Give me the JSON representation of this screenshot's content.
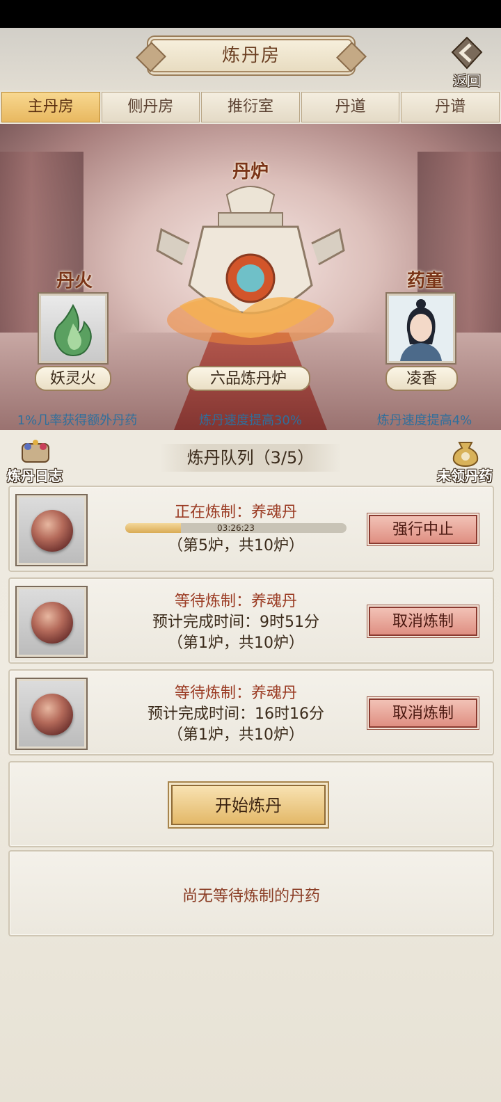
{
  "header": {
    "title": "炼丹房",
    "back_label": "返回"
  },
  "tabs": [
    {
      "label": "主丹房",
      "active": true
    },
    {
      "label": "侧丹房"
    },
    {
      "label": "推衍室"
    },
    {
      "label": "丹道"
    },
    {
      "label": "丹谱"
    }
  ],
  "scene": {
    "furnace_tag": "丹炉",
    "fire_tag": "丹火",
    "boy_tag": "药童",
    "fire_name": "妖灵火",
    "furnace_name": "六品炼丹炉",
    "boy_name": "凌香",
    "fire_desc": "1%几率获得额外丹药",
    "furnace_desc": "炼丹速度提高30%",
    "boy_desc": "炼丹速度提高4%"
  },
  "queue": {
    "title": "炼丹队列（3/5）",
    "log_label": "炼丹日志",
    "unclaimed_label": "未领丹药",
    "items": [
      {
        "status": "正在炼制：养魂丹",
        "timer": "03:26:23",
        "progress": 0.25,
        "count": "（第5炉，共10炉）",
        "action": "强行中止"
      },
      {
        "status": "等待炼制：养魂丹",
        "eta": "预计完成时间：9时51分",
        "count": "（第1炉，共10炉）",
        "action": "取消炼制"
      },
      {
        "status": "等待炼制：养魂丹",
        "eta": "预计完成时间：16时16分",
        "count": "（第1炉，共10炉）",
        "action": "取消炼制"
      }
    ],
    "start_label": "开始炼丹",
    "empty_text": "尚无等待炼制的丹药"
  },
  "colors": {
    "accent": "#e8b860",
    "desc_blue": "#2f6f9c",
    "danger_btn": "#df8f82"
  }
}
